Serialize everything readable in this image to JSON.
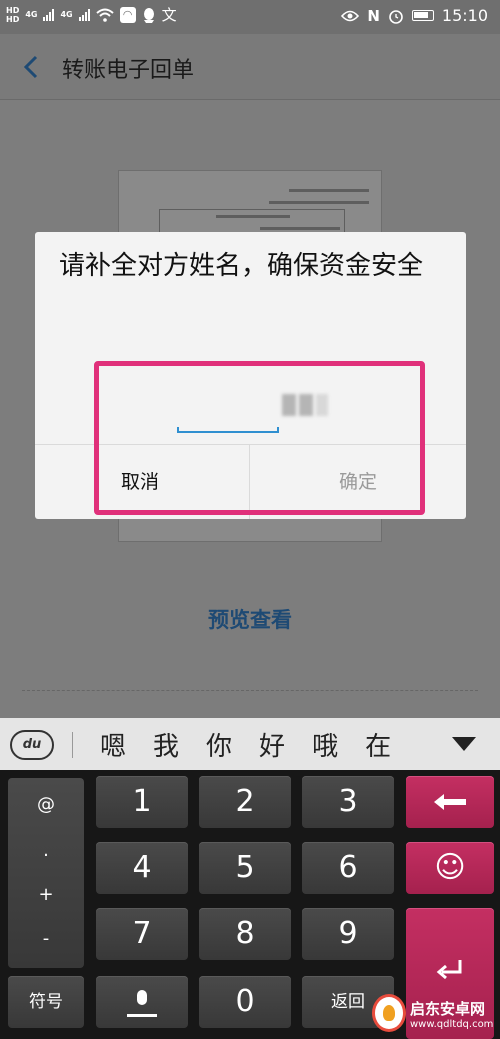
{
  "status_bar": {
    "hd1": "HD",
    "hd2": "HD",
    "net1": "4G",
    "net2": "4G",
    "time": "15:10",
    "icons": [
      "signal-icon",
      "signal-icon",
      "wifi-icon",
      "app-icon",
      "qq-icon",
      "translate-icon",
      "eye-icon",
      "nfc-icon",
      "alarm-icon",
      "battery-icon"
    ]
  },
  "header": {
    "title": "转账电子回单"
  },
  "document": {
    "preview_link": "预览查看"
  },
  "dialog": {
    "message": "请补全对方姓名，确保资金安全",
    "cancel_label": "取消",
    "confirm_label": "确定"
  },
  "highlight_color": "#e0307a",
  "ime": {
    "logo": "du",
    "candidates": [
      "嗯",
      "我",
      "你",
      "好",
      "哦",
      "在"
    ]
  },
  "keyboard": {
    "symbols": [
      "@",
      ".",
      "+",
      "-"
    ],
    "digits": [
      "1",
      "2",
      "3",
      "4",
      "5",
      "6",
      "7",
      "8",
      "9",
      "0"
    ],
    "symbol_key": "符号",
    "return_key": "返回",
    "smiley": "☺",
    "accent_color": "#b82857"
  },
  "watermark": {
    "name": "启东安卓网",
    "url": "www.qdltdq.com"
  }
}
